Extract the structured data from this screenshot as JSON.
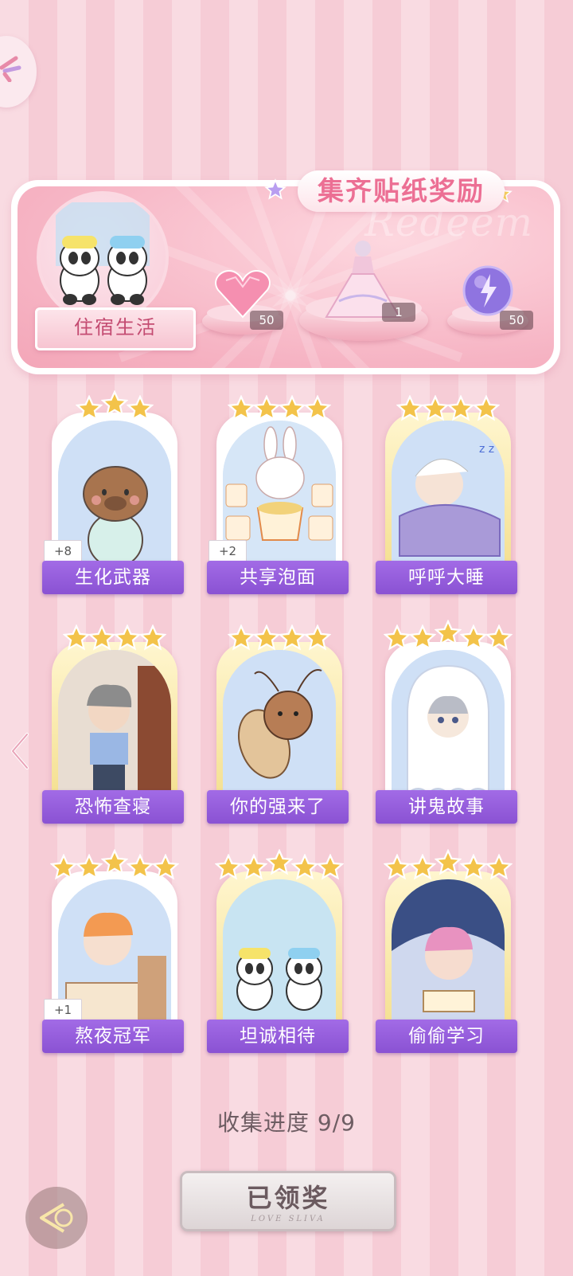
{
  "banner": {
    "title": "集齐贴纸奖励",
    "watermark": "Redeem",
    "album_label": "住宿生活",
    "rewards": [
      {
        "icon": "heart-gem-icon",
        "count": "50"
      },
      {
        "icon": "dress-outfit-icon",
        "count": "1"
      },
      {
        "icon": "lightning-orb-icon",
        "count": "50"
      }
    ]
  },
  "cards": [
    {
      "label": "生化武器",
      "stars": 3,
      "bonus": "+8",
      "art": "capybara-icon",
      "frame": "white"
    },
    {
      "label": "共享泡面",
      "stars": 4,
      "bonus": "+2",
      "art": "bunny-noodles-icon",
      "frame": "white"
    },
    {
      "label": "呼呼大睡",
      "stars": 4,
      "bonus": "",
      "art": "sleeping-boy-icon",
      "frame": "gold"
    },
    {
      "label": "恐怖查寝",
      "stars": 4,
      "bonus": "",
      "art": "dorm-auntie-icon",
      "frame": "gold"
    },
    {
      "label": "你的强来了",
      "stars": 4,
      "bonus": "",
      "art": "cockroach-icon",
      "frame": "gold"
    },
    {
      "label": "讲鬼故事",
      "stars": 5,
      "bonus": "",
      "art": "ghost-boy-icon",
      "frame": "white"
    },
    {
      "label": "熬夜冠军",
      "stars": 5,
      "bonus": "+1",
      "art": "gaming-boy-icon",
      "frame": "white"
    },
    {
      "label": "坦诚相待",
      "stars": 5,
      "bonus": "",
      "art": "pandas-bath-icon",
      "frame": "gold"
    },
    {
      "label": "偷偷学习",
      "stars": 5,
      "bonus": "",
      "art": "studying-boy-icon",
      "frame": "gold"
    }
  ],
  "progress": "收集进度  9/9",
  "claim_button": {
    "label": "已领奖",
    "subtext": "LOVE SLIVA"
  },
  "colors": {
    "label_purple": "#8a52d3",
    "star_gold": "#f3c34a",
    "title_pink": "#ec6f94"
  }
}
